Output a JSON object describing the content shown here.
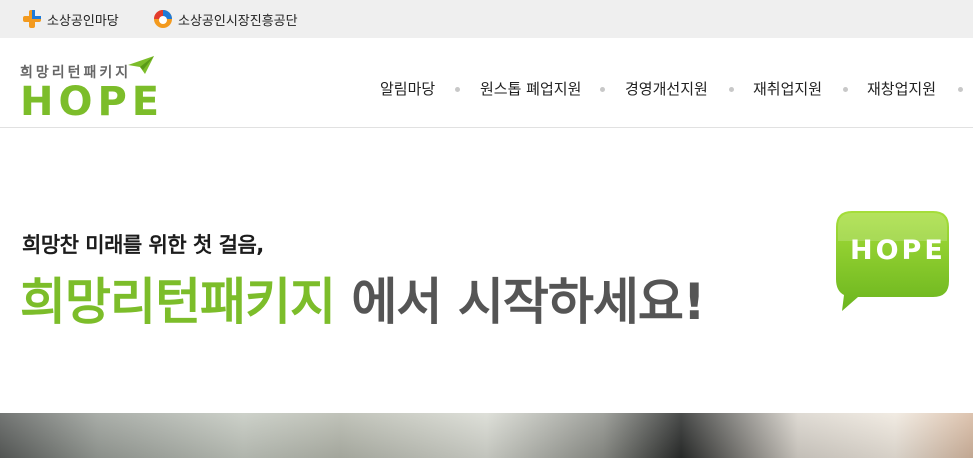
{
  "topbar": {
    "links": [
      {
        "label": "소상공인마당",
        "icon": "plus-logo-icon"
      },
      {
        "label": "소상공인시장진흥공단",
        "icon": "agency-logo-icon"
      }
    ]
  },
  "header": {
    "logo": {
      "sub": "희망리턴패키지",
      "main": "HOPE"
    },
    "nav": [
      "알림마당",
      "원스톱 폐업지원",
      "경영개선지원",
      "재취업지원",
      "재창업지원"
    ]
  },
  "hero": {
    "subtitle": "희망찬 미래를 위한 첫 걸음,",
    "title_green": "희망리턴패키지",
    "title_gray": " 에서 시작하세요!",
    "bubble_text": "HOPE"
  },
  "colors": {
    "brand_green": "#7cbd2a",
    "gray_text": "#555555",
    "topbar_bg": "#efefef"
  }
}
